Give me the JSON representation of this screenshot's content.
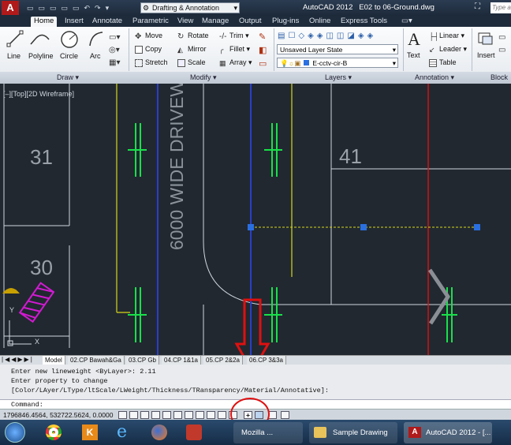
{
  "app_menu_icon": "autocad-a-icon",
  "workspace": "Drafting & Annotation",
  "window_title": "AutoCAD 2012",
  "file_name": "E02 to 06-Ground.dwg",
  "search_placeholder": "Type a",
  "ribbon_tabs": [
    "Home",
    "Insert",
    "Annotate",
    "Parametric",
    "View",
    "Manage",
    "Output",
    "Plug-ins",
    "Online",
    "Express Tools"
  ],
  "active_tab": "Home",
  "draw": {
    "line": "Line",
    "polyline": "Polyline",
    "circle": "Circle",
    "arc": "Arc",
    "panel": "Draw"
  },
  "modify": {
    "move": "Move",
    "rotate": "Rotate",
    "trim": "Trim",
    "copy": "Copy",
    "mirror": "Mirror",
    "fillet": "Fillet",
    "stretch": "Stretch",
    "scale": "Scale",
    "array": "Array",
    "panel": "Modify"
  },
  "layers": {
    "layer_state": "Unsaved Layer State",
    "current_layer": "E-cctv-cir-B",
    "panel": "Layers"
  },
  "annotation": {
    "text": "Text",
    "linear": "Linear",
    "leader": "Leader",
    "table": "Table",
    "panel": "Annotation"
  },
  "block": {
    "insert": "Insert",
    "panel": "Block"
  },
  "viewport": {
    "label": "[–][Top][2D Wireframe]",
    "room_31": "31",
    "room_30": "30",
    "room_41": "41",
    "drive_label": "6000 WIDE DRIVEW",
    "ucs_y": "Y",
    "ucs_x": "X"
  },
  "layout_tabs": [
    "Model",
    "02.CP Bawah&Ga",
    "03.CP Gb",
    "04.CP 1&1a",
    "05.CP 2&2a",
    "06.CP 3&3a"
  ],
  "active_layout": "Model",
  "command_history": [
    "Enter new lineweight <ByLayer>: 2.11",
    "Enter property to change",
    "[Color/LAyer/LType/ltScale/LWeight/Thickness/TRansparency/Material/Annotative]:"
  ],
  "command_prompt": "Command:",
  "coordinates": "1796846.4564, 532722.5624, 0.0000",
  "taskbar": {
    "items": [
      "Mozilla ...",
      "Sample Drawing",
      "AutoCAD 2012 - [..."
    ]
  },
  "colors": {
    "accent_red": "#e01010",
    "green_line": "#19e04a",
    "yellow_line": "#d6d61a",
    "blue_line": "#2a3fc8",
    "grip_blue": "#2a6fe0"
  }
}
